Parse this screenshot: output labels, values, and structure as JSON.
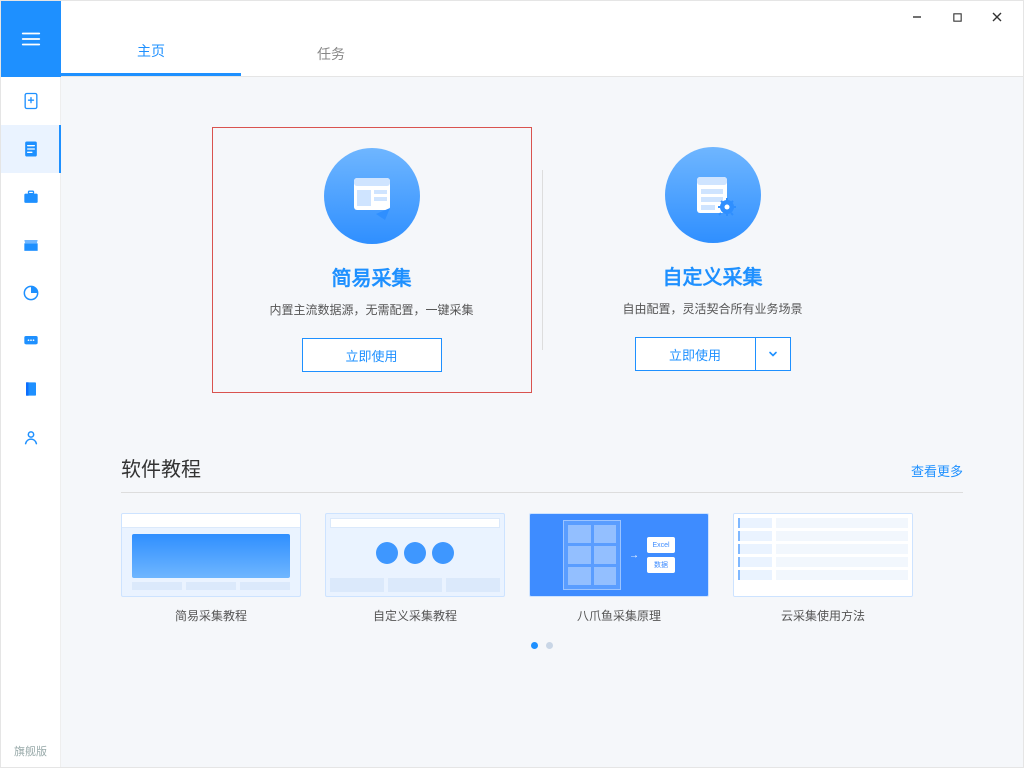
{
  "window": {
    "min": "—",
    "max": "▢",
    "close": "✕"
  },
  "tabs": [
    {
      "label": "主页",
      "active": true
    },
    {
      "label": "任务",
      "active": false
    }
  ],
  "cards": [
    {
      "title": "简易采集",
      "desc": "内置主流数据源，无需配置，一键采集",
      "button": "立即使用"
    },
    {
      "title": "自定义采集",
      "desc": "自由配置，灵活契合所有业务场景",
      "button": "立即使用"
    }
  ],
  "tutorials": {
    "title": "软件教程",
    "more": "查看更多",
    "items": [
      {
        "caption": "简易采集教程"
      },
      {
        "caption": "自定义采集教程"
      },
      {
        "caption": "八爪鱼采集原理"
      },
      {
        "caption": "云采集使用方法"
      }
    ]
  },
  "footer": {
    "edition": "旗舰版"
  },
  "dots": {
    "active": 0,
    "count": 2
  }
}
